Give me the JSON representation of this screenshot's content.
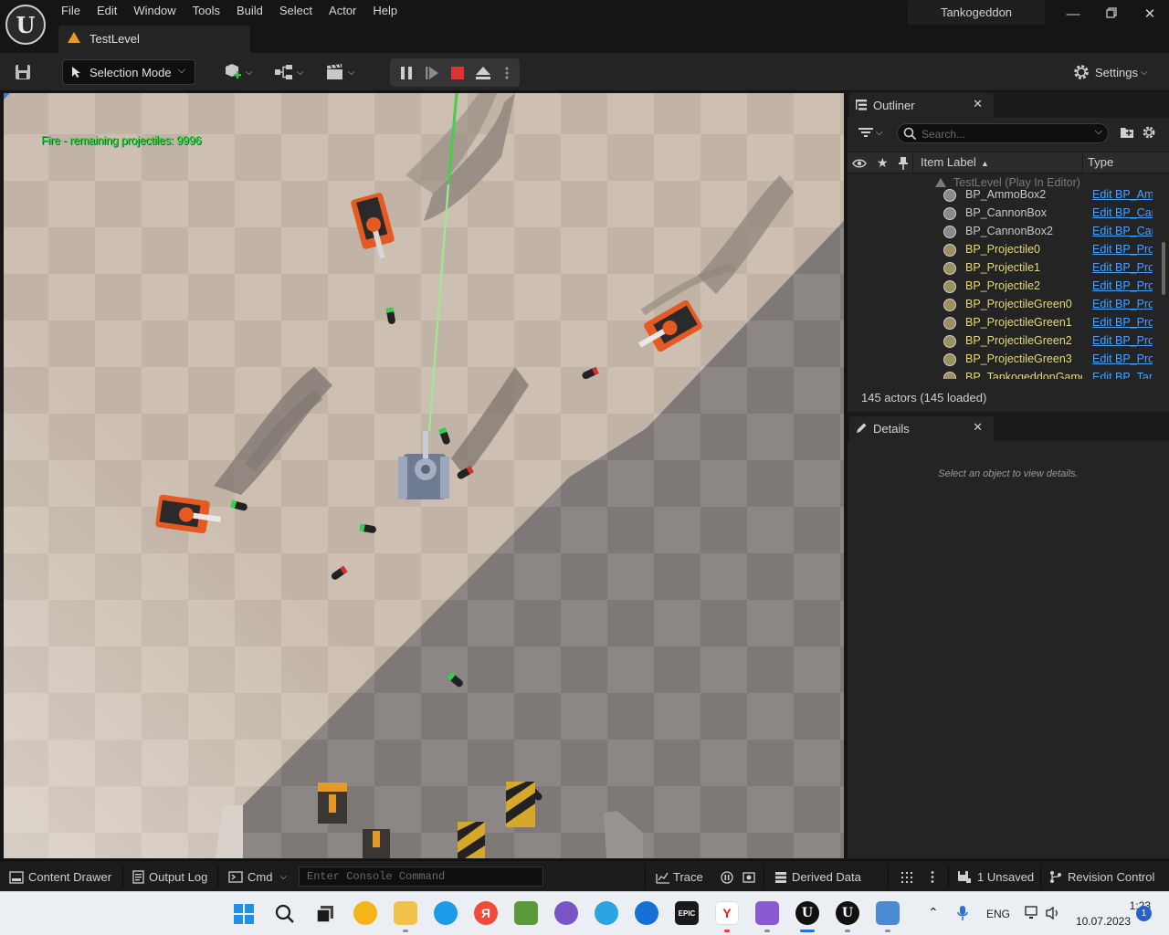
{
  "app": {
    "menu": [
      "File",
      "Edit",
      "Window",
      "Tools",
      "Build",
      "Select",
      "Actor",
      "Help"
    ],
    "project_name": "Tankogeddon",
    "level_tab": "TestLevel"
  },
  "toolbar": {
    "selection_mode": "Selection Mode",
    "settings": "Settings"
  },
  "viewport": {
    "hud_text": "Fire - remaining projectiles: 9996"
  },
  "outliner": {
    "tab_label": "Outliner",
    "search_placeholder": "Search...",
    "col_label": "Item Label",
    "col_type": "Type",
    "level_row": "TestLevel (Play In Editor)",
    "rows": [
      {
        "label": "BP_AmmoBox2",
        "type": "Edit BP_Am",
        "color": "#c8c8c8"
      },
      {
        "label": "BP_CannonBox",
        "type": "Edit BP_Can",
        "color": "#c8c8c8"
      },
      {
        "label": "BP_CannonBox2",
        "type": "Edit BP_Can",
        "color": "#c8c8c8"
      },
      {
        "label": "BP_Projectile0",
        "type": "Edit BP_Pro",
        "color": "#e6d87a"
      },
      {
        "label": "BP_Projectile1",
        "type": "Edit BP_Pro",
        "color": "#e6d87a"
      },
      {
        "label": "BP_Projectile2",
        "type": "Edit BP_Pro",
        "color": "#e6d87a"
      },
      {
        "label": "BP_ProjectileGreen0",
        "type": "Edit BP_Pro",
        "color": "#e6d87a"
      },
      {
        "label": "BP_ProjectileGreen1",
        "type": "Edit BP_Pro",
        "color": "#e6d87a"
      },
      {
        "label": "BP_ProjectileGreen2",
        "type": "Edit BP_Pro",
        "color": "#e6d87a"
      },
      {
        "label": "BP_ProjectileGreen3",
        "type": "Edit BP_Pro",
        "color": "#e6d87a"
      },
      {
        "label": "BP_TankogeddonGame",
        "type": "Edit BP_Tan",
        "color": "#e6d87a"
      }
    ],
    "actor_count": "145 actors (145 loaded)"
  },
  "details": {
    "tab_label": "Details",
    "empty_text": "Select an object to view details."
  },
  "statusbar": {
    "content_drawer": "Content Drawer",
    "output_log": "Output Log",
    "cmd": "Cmd",
    "console_placeholder": "Enter Console Command",
    "trace": "Trace",
    "derived_data": "Derived Data",
    "unsaved": "1 Unsaved",
    "revision_control": "Revision Control"
  },
  "taskbar": {
    "language": "ENG",
    "time": "1:23",
    "date": "10.07.2023",
    "notifications": "1"
  }
}
